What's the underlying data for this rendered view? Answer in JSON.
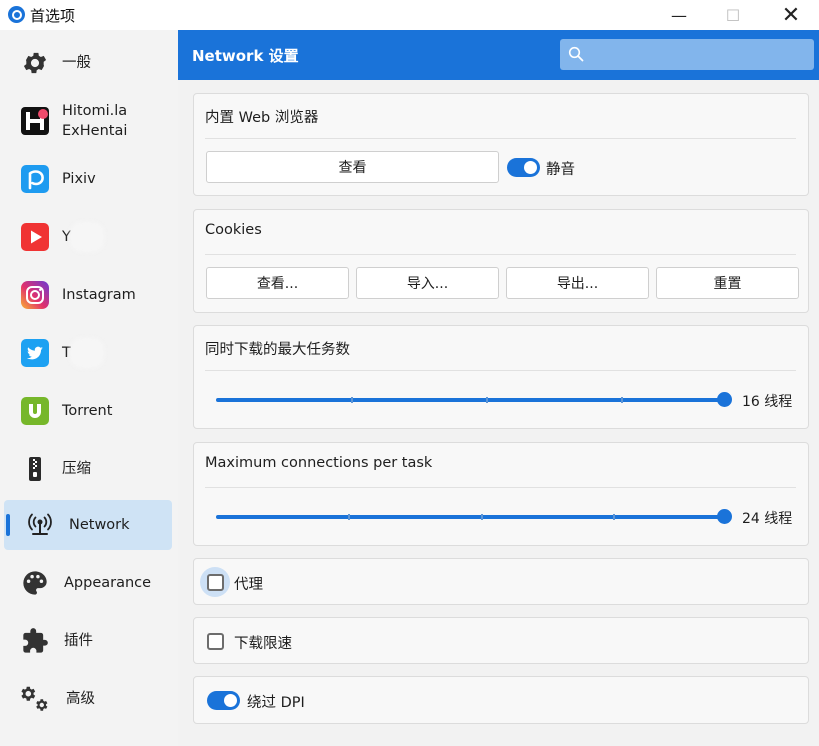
{
  "window": {
    "title": "首选项",
    "minimize": "—",
    "maximize": "☐",
    "close": "✕"
  },
  "colors": {
    "accent": "#1a73d9",
    "sidebar_active": "#cfe3f5"
  },
  "sidebar": {
    "items": [
      {
        "label": "一般",
        "icon": "gear-icon"
      },
      {
        "label_line1": "Hitomi.la",
        "label_line2": "ExHentai",
        "icon": "hitomi-icon"
      },
      {
        "label": "Pixiv",
        "icon": "pixiv-icon"
      },
      {
        "label": "Y     be",
        "icon": "youtube-icon"
      },
      {
        "label": "Instagram",
        "icon": "instagram-icon"
      },
      {
        "label": "T     ter",
        "icon": "twitter-icon"
      },
      {
        "label": "Torrent",
        "icon": "utorrent-icon"
      },
      {
        "label": "压缩",
        "icon": "zip-icon"
      },
      {
        "label": "Network",
        "icon": "antenna-icon",
        "active": true
      },
      {
        "label": "Appearance",
        "icon": "palette-icon"
      },
      {
        "label": "插件",
        "icon": "puzzle-icon"
      },
      {
        "label": "高级",
        "icon": "gears-icon"
      }
    ]
  },
  "header": {
    "title": "Network 设置",
    "search_placeholder": ""
  },
  "browser": {
    "title": "内置 Web 浏览器",
    "view_button": "查看",
    "mute_label": "静音",
    "mute_on": true
  },
  "cookies": {
    "title": "Cookies",
    "buttons": [
      "查看...",
      "导入...",
      "导出...",
      "重置"
    ]
  },
  "max_tasks": {
    "title": "同时下载的最大任务数",
    "value_label": "16  线程",
    "value": 16,
    "max": 16
  },
  "max_connections": {
    "title": "Maximum connections per task",
    "value_label": "24  线程",
    "value": 24,
    "max": 24
  },
  "proxy": {
    "label": "代理",
    "checked": false
  },
  "speed_limit": {
    "label": "下载限速",
    "checked": false
  },
  "bypass_dpi": {
    "label": "绕过 DPI",
    "on": true
  }
}
